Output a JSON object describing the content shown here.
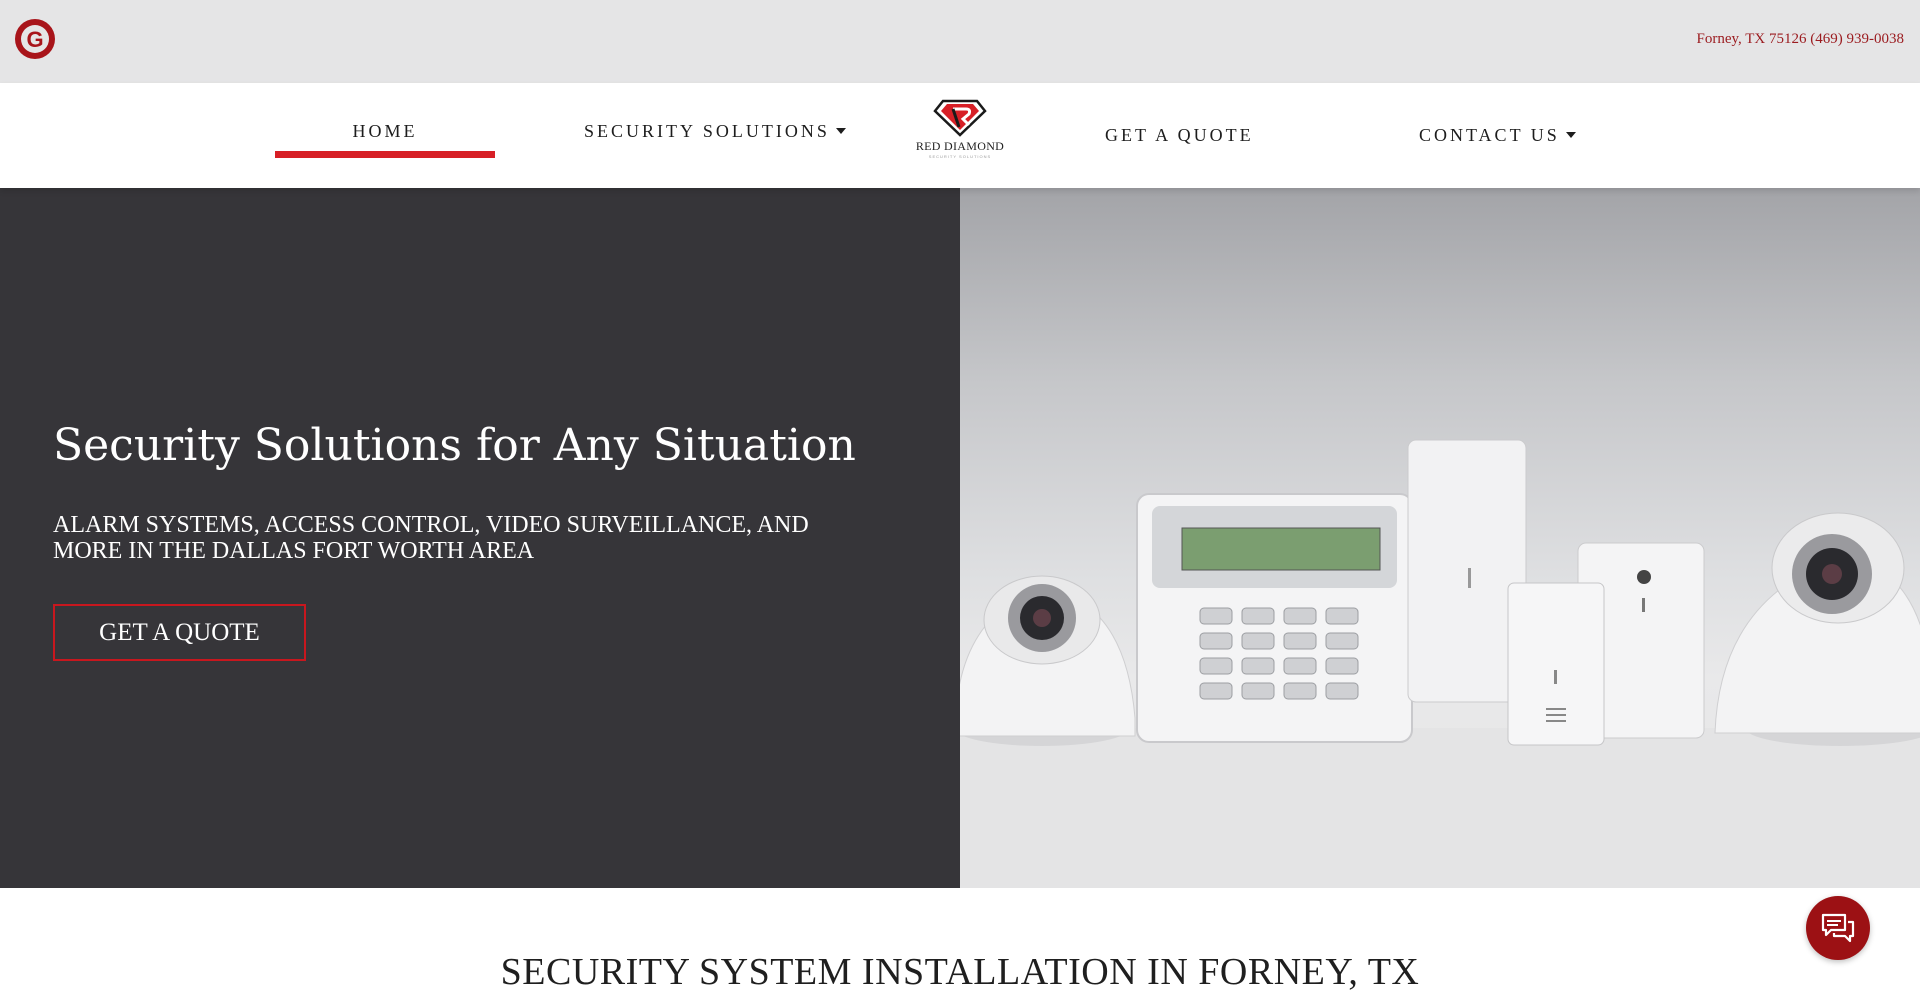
{
  "header": {
    "logo_icon": "g-circle-icon",
    "contact_line": "Forney, TX 75126 (469) 939-0038"
  },
  "nav": {
    "home": "HOME",
    "security_solutions": "SECURITY SOLUTIONS",
    "get_quote": "GET A QUOTE",
    "contact_us": "CONTACT US",
    "brand_name": "RED DIAMOND",
    "brand_sub": "SECURITY SOLUTIONS"
  },
  "hero": {
    "title": "Security Solutions for Any Situation",
    "subtitle": "ALARM SYSTEMS, ACCESS CONTROL, VIDEO SURVEILLANCE, AND MORE IN THE DALLAS FORT WORTH AREA",
    "button_label": "GET A QUOTE",
    "image_description_icon": "security-devices-image"
  },
  "section": {
    "title": "SECURITY SYSTEM INSTALLATION IN FORNEY, TX"
  },
  "colors": {
    "accent_red": "#d71f26",
    "dark_red": "#9c1114",
    "hero_dark": "#363539",
    "topbar_gray": "#e5e5e6"
  },
  "chat": {
    "icon": "chat-bubbles-icon"
  }
}
